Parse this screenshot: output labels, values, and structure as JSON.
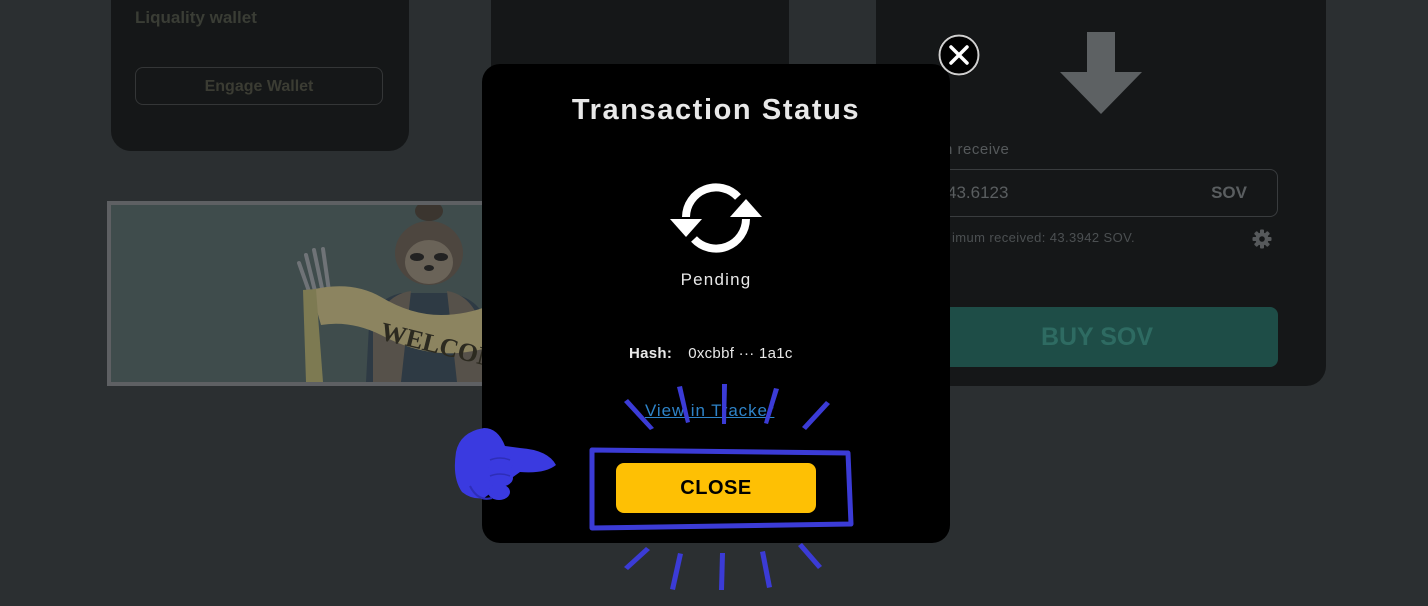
{
  "background": {
    "left_card": {
      "wallet_title": "Liquality wallet",
      "engage_button": "Engage Wallet"
    },
    "right_card": {
      "receive_label": "n receive",
      "receive_value": "43.6123",
      "receive_unit": "SOV",
      "min_received": "imum received: 43.3942 SOV.",
      "buy_button": "BUY SOV"
    },
    "banner_text": "WELCOM"
  },
  "modal": {
    "title": "Transaction Status",
    "status": "Pending",
    "hash_label": "Hash:",
    "hash_value": "0xcbbf ··· 1a1c",
    "tracker_link": "View in Tracker",
    "close_button": "CLOSE"
  },
  "icons": {
    "modal_close": "close-icon",
    "status": "refresh-icon",
    "pointer": "pointing-hand-icon",
    "swap_direction": "arrow-down-icon",
    "settings": "gear-icon"
  },
  "colors": {
    "page_bg": "#2b2f31",
    "card_bg": "#151718",
    "modal_bg": "#000000",
    "close_button_bg": "#fec004",
    "highlight": "#3b3bd6",
    "link": "#2e83c8",
    "buy_button_bg": "#1e4d47"
  }
}
